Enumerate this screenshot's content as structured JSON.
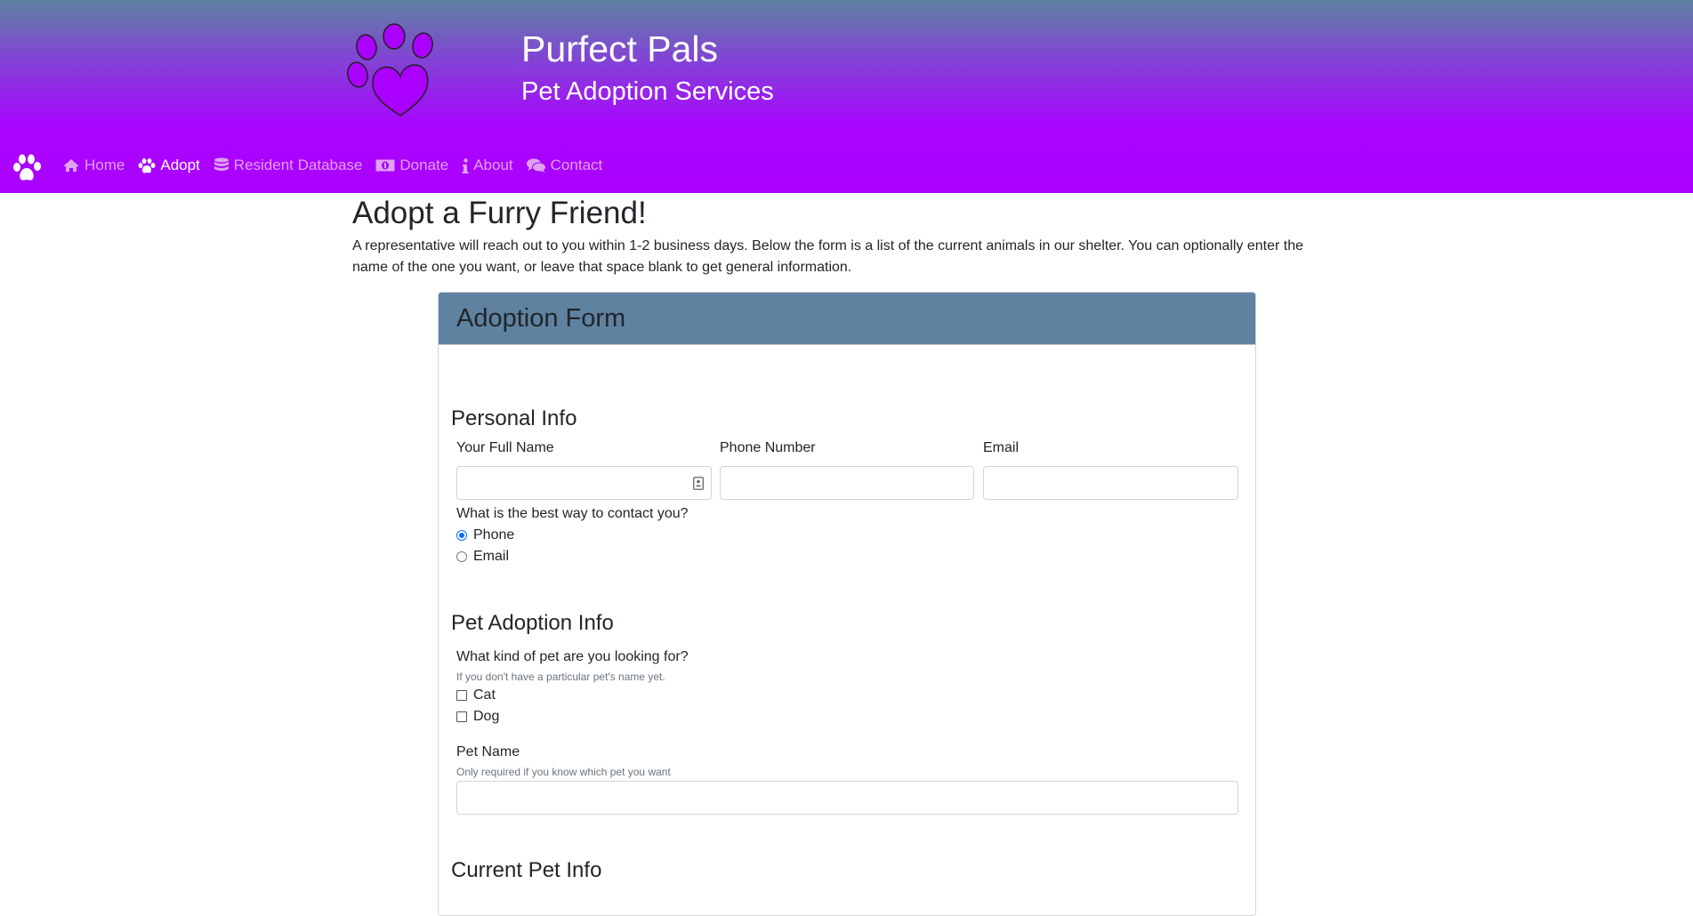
{
  "header": {
    "title": "Purfect Pals",
    "subtitle": "Pet Adoption Services",
    "logo_icon": "paw-heart-logo",
    "gradient_colors": [
      "#5f82a1",
      "#aa00ff"
    ]
  },
  "nav": {
    "brand_icon": "paw-icon",
    "items": [
      {
        "label": "Home",
        "icon": "home-icon",
        "active": false
      },
      {
        "label": "Adopt",
        "icon": "paw-icon",
        "active": true
      },
      {
        "label": "Resident Database",
        "icon": "database-icon",
        "active": false
      },
      {
        "label": "Donate",
        "icon": "money-icon",
        "active": false
      },
      {
        "label": "About",
        "icon": "info-icon",
        "active": false
      },
      {
        "label": "Contact",
        "icon": "comments-icon",
        "active": false
      }
    ]
  },
  "page": {
    "title": "Adopt a Furry Friend!",
    "intro": "A representative will reach out to you within 1-2 business days. Below the form is a list of the current animals in our shelter. You can optionally enter the name of the one you want, or leave that space blank to get general information."
  },
  "form": {
    "title": "Adoption Form",
    "header_color": "#5f82a1",
    "personal": {
      "section_title": "Personal Info",
      "name_label": "Your Full Name",
      "name_value": "",
      "phone_label": "Phone Number",
      "phone_value": "",
      "email_label": "Email",
      "email_value": "",
      "contact_question": "What is the best way to contact you?",
      "contact_options": [
        {
          "label": "Phone",
          "checked": true
        },
        {
          "label": "Email",
          "checked": false
        }
      ]
    },
    "pet": {
      "section_title": "Pet Adoption Info",
      "kind_question": "What kind of pet are you looking for?",
      "kind_help": "If you don't have a particular pet's name yet.",
      "kind_options": [
        {
          "label": "Cat",
          "checked": false
        },
        {
          "label": "Dog",
          "checked": false
        }
      ],
      "name_label": "Pet Name",
      "name_help": "Only required if you know which pet you want",
      "name_value": ""
    },
    "current": {
      "section_title": "Current Pet Info"
    }
  }
}
